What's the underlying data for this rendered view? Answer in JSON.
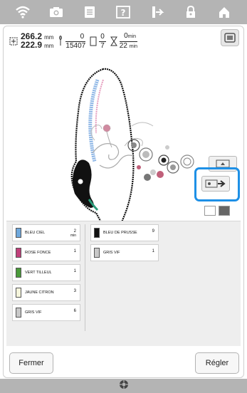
{
  "top_icons": [
    "wifi-icon",
    "camera-icon",
    "document-icon",
    "help-icon",
    "thread-icon",
    "lock-icon",
    "home-icon"
  ],
  "info": {
    "width_value": "266.2",
    "height_value": "222.9",
    "size_unit": "mm",
    "stitch_current": "0",
    "stitch_total": "15407",
    "color_current": "0",
    "color_total": "7",
    "time_current": "0",
    "time_total": "22",
    "time_unit": "min"
  },
  "threads": {
    "left": [
      {
        "name": "BLEU CIEL",
        "count": "2",
        "unit": "min"
      },
      {
        "name": "ROSE FONCE",
        "count": "1",
        "unit": ""
      },
      {
        "name": "VERT TILLEUL",
        "count": "1",
        "unit": ""
      },
      {
        "name": "JAUNE CITRON",
        "count": "3",
        "unit": ""
      },
      {
        "name": "GRIS VIF",
        "count": "6",
        "unit": ""
      }
    ],
    "right": [
      {
        "name": "BLEU DE PRUSSE",
        "count": "9",
        "unit": ""
      },
      {
        "name": "GRIS VIF",
        "count": "1",
        "unit": ""
      }
    ]
  },
  "buttons": {
    "close": "Fermer",
    "set": "Régler"
  },
  "colors": {
    "accent": "#1e90e6",
    "bar": "#b4b4b4"
  }
}
